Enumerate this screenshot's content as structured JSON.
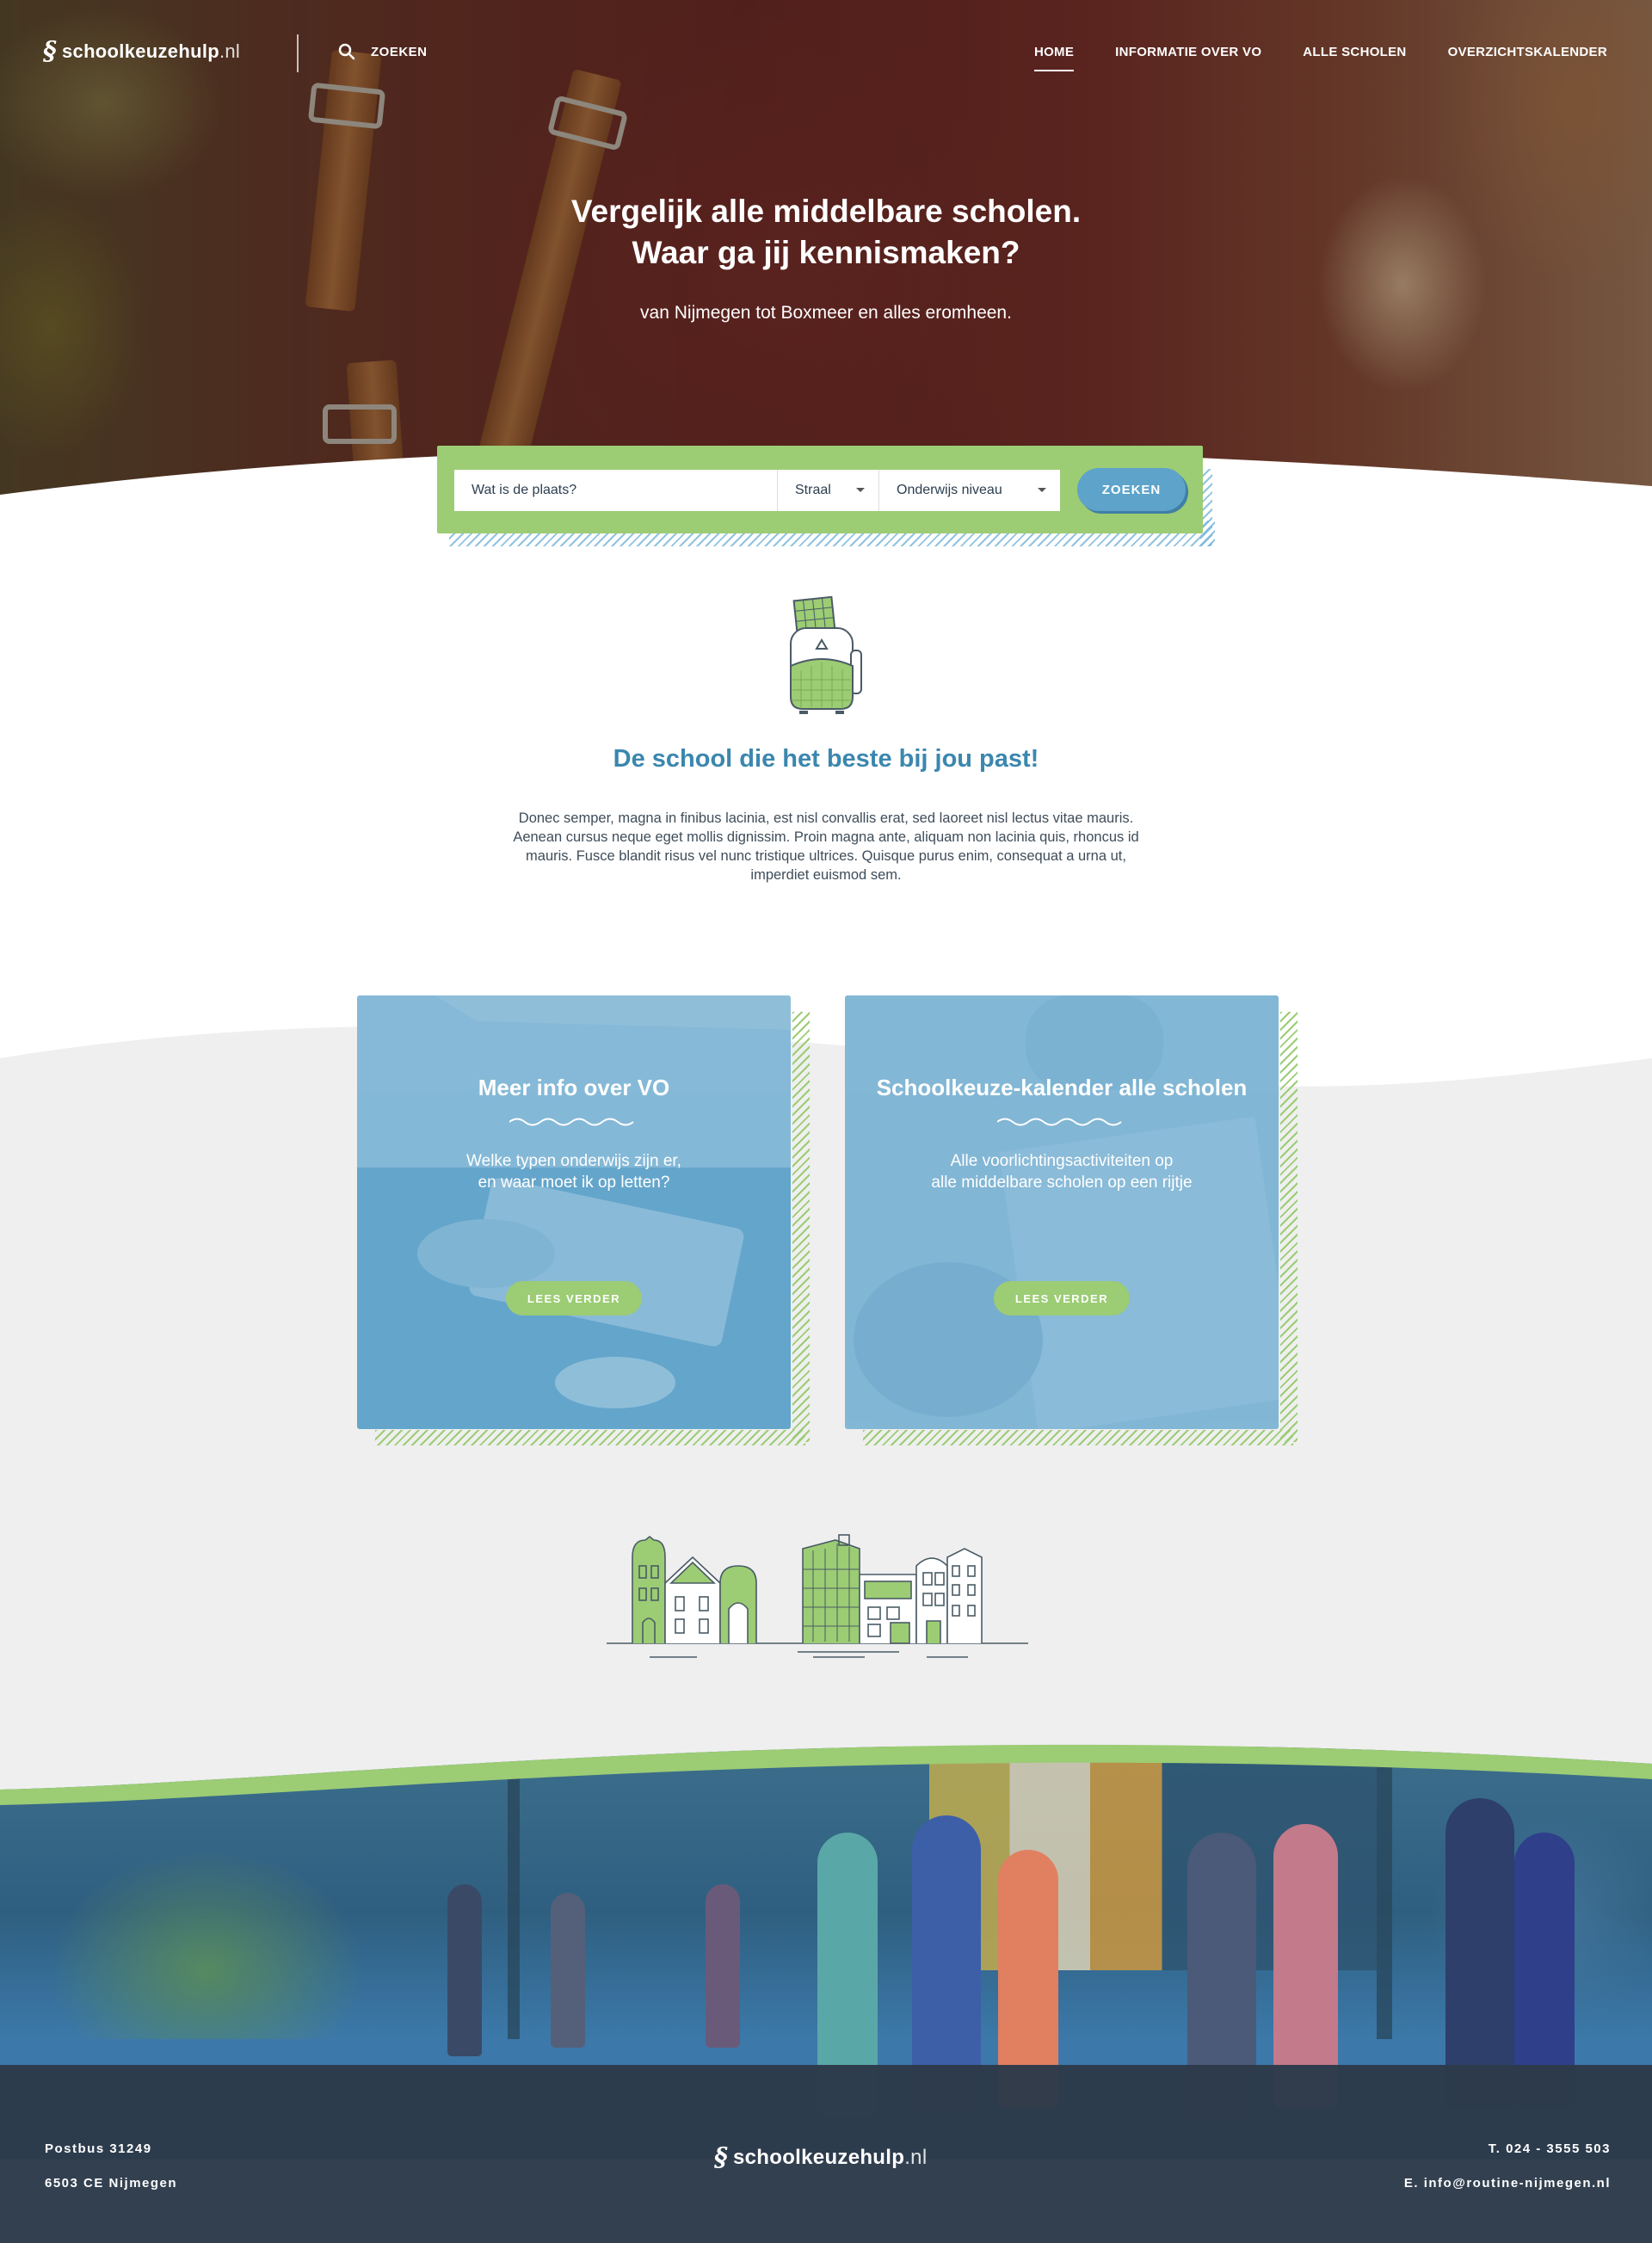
{
  "brand": {
    "name": "schoolkeuzehulp",
    "tld": ".nl"
  },
  "nav": {
    "search_label": "ZOEKEN",
    "links": [
      {
        "label": "HOME",
        "active": true
      },
      {
        "label": "INFORMATIE OVER VO",
        "active": false
      },
      {
        "label": "ALLE SCHOLEN",
        "active": false
      },
      {
        "label": "OVERZICHTSKALENDER",
        "active": false
      }
    ]
  },
  "hero": {
    "title_line1": "Vergelijk alle middelbare scholen.",
    "title_line2": "Waar ga jij kennismaken?",
    "subtitle": "van Nijmegen tot Boxmeer en alles eromheen."
  },
  "search": {
    "place_placeholder": "Wat is de plaats?",
    "radius_value": "Straal",
    "level_value": "Onderwijs niveau",
    "button_label": "ZOEKEN"
  },
  "intro": {
    "title": "De school die het beste bij jou past!",
    "text": "Donec semper, magna in finibus lacinia, est nisl convallis erat, sed laoreet nisl lectus vitae mauris. Aenean cursus neque eget mollis dignissim. Proin magna ante, aliquam non lacinia quis, rhoncus id mauris. Fusce blandit risus vel nunc tristique ultrices. Quisque purus enim, consequat a urna ut, imperdiet euismod sem."
  },
  "cards": [
    {
      "title": "Meer info over VO",
      "text_line1": "Welke typen onderwijs zijn er,",
      "text_line2": "en waar moet ik op letten?",
      "button": "LEES VERDER"
    },
    {
      "title": "Schoolkeuze-kalender alle scholen",
      "text_line1": "Alle voorlichtingsactiviteiten op",
      "text_line2": "alle middelbare scholen op een rijtje",
      "button": "LEES VERDER"
    }
  ],
  "footer": {
    "address_line1": "Postbus 31249",
    "address_line2": "6503 CE Nijmegen",
    "phone": "T. 024 - 3555 503",
    "email": "E. info@routine-nijmegen.nl"
  },
  "colors": {
    "green": "#9ccc74",
    "blue": "#64a5cb",
    "title_blue": "#3b87ae",
    "footer": "#2c3a4a",
    "grey_section": "#efefef"
  }
}
